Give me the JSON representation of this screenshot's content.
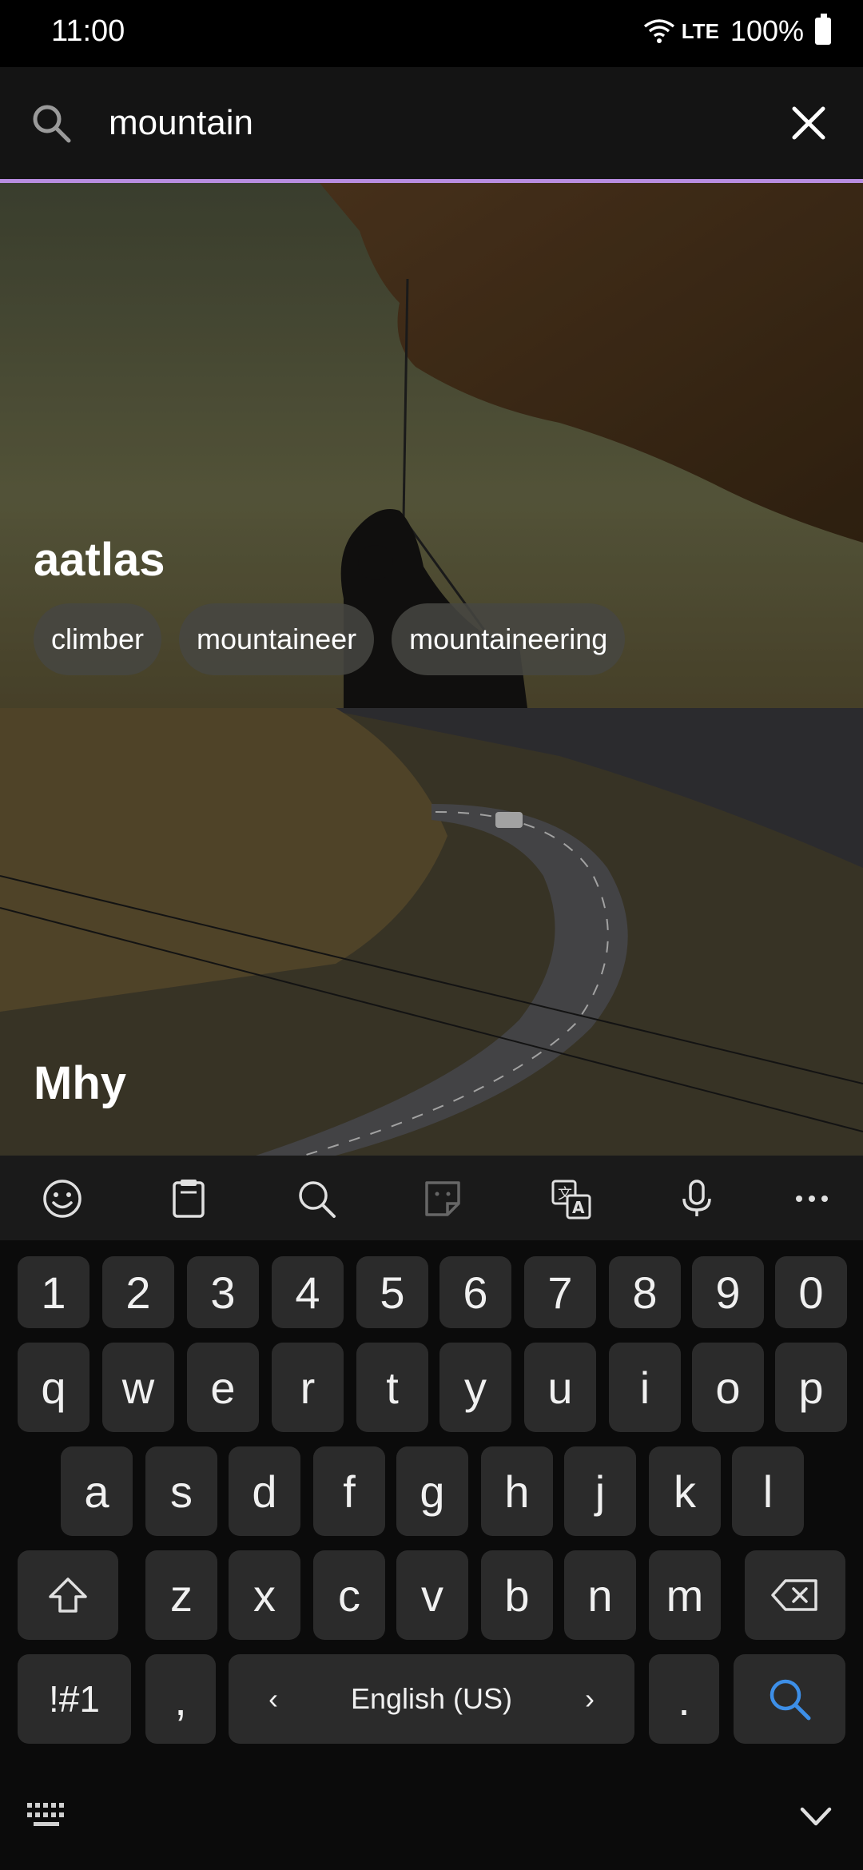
{
  "status_bar": {
    "time": "11:00",
    "network": "LTE",
    "battery": "100%"
  },
  "search": {
    "query": "mountain",
    "placeholder": ""
  },
  "results": [
    {
      "title": "aatlas",
      "tags": [
        "climber",
        "mountaineer",
        "mountaineering"
      ]
    },
    {
      "title": "Mhy",
      "tags": []
    }
  ],
  "keyboard": {
    "number_row": [
      "1",
      "2",
      "3",
      "4",
      "5",
      "6",
      "7",
      "8",
      "9",
      "0"
    ],
    "row1": [
      "q",
      "w",
      "e",
      "r",
      "t",
      "y",
      "u",
      "i",
      "o",
      "p"
    ],
    "row2": [
      "a",
      "s",
      "d",
      "f",
      "g",
      "h",
      "j",
      "k",
      "l"
    ],
    "row3": [
      "z",
      "x",
      "c",
      "v",
      "b",
      "n",
      "m"
    ],
    "symbols_label": "!#1",
    "comma": ",",
    "period": ".",
    "space_label": "English (US)",
    "lang_left": "‹",
    "lang_right": "›",
    "toolbar_icons": [
      "emoji-icon",
      "clipboard-icon",
      "search-icon",
      "sticker-icon",
      "translate-icon",
      "microphone-icon",
      "more-icon"
    ]
  },
  "colors": {
    "accent_underline": "#b88de0",
    "search_key": "#3d8fe8"
  }
}
